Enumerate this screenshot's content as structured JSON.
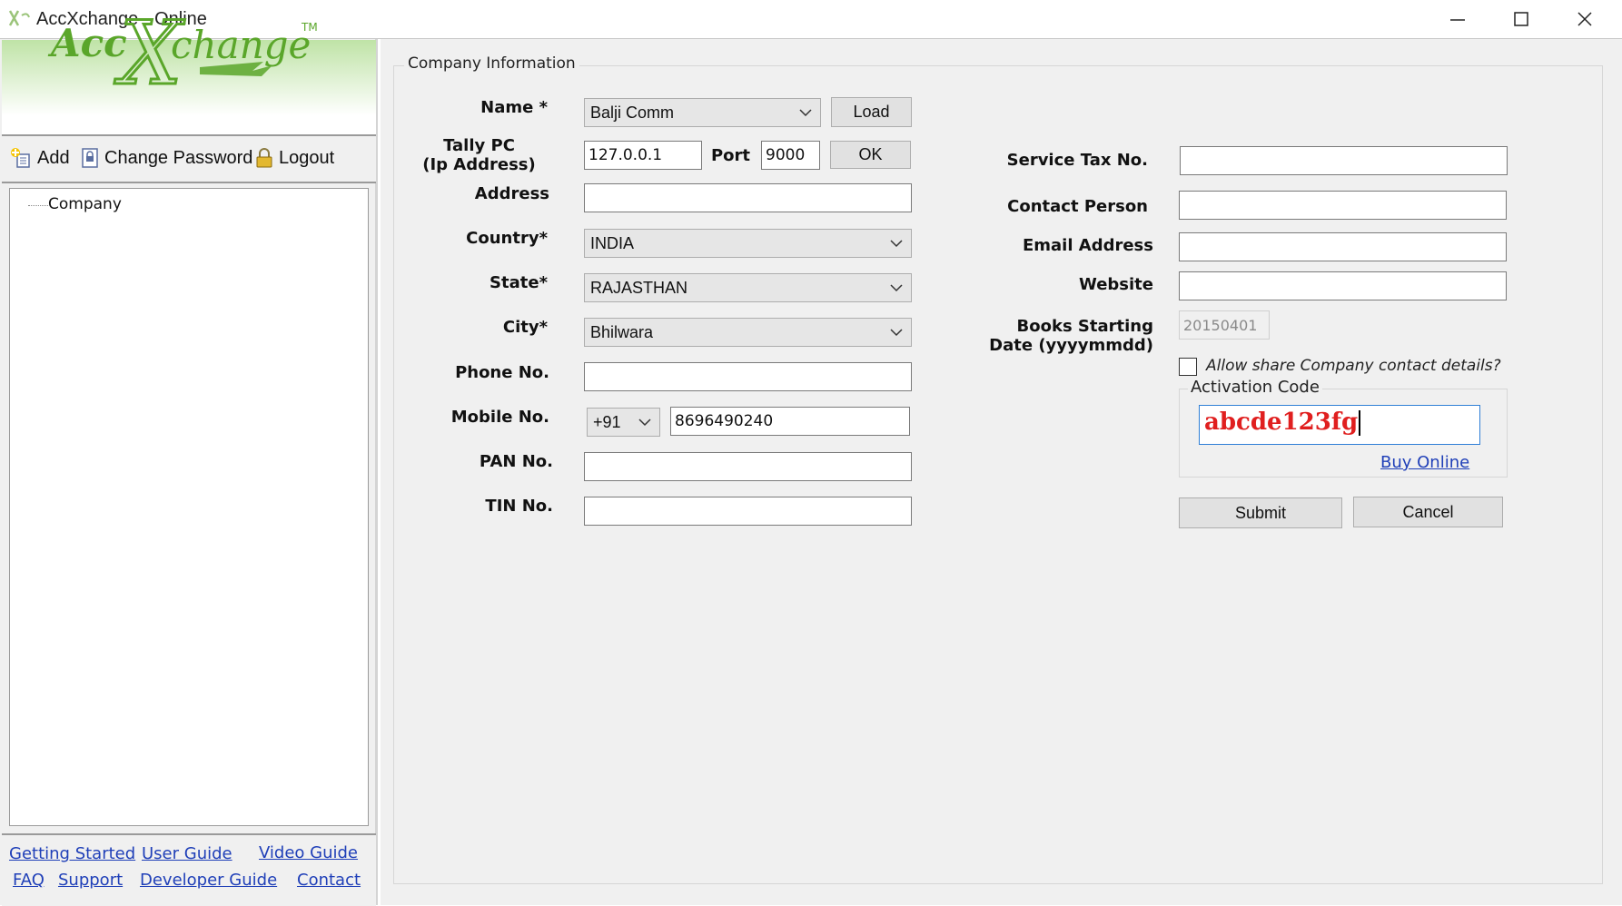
{
  "window": {
    "title": "AccXchange - Online"
  },
  "logo": {
    "text_acc": "Acc",
    "text_x": "X",
    "text_change": "change",
    "tm": "TM",
    "color": "#5aa62a"
  },
  "toolbar": {
    "add_label": "Add",
    "change_password_label": "Change Password",
    "logout_label": "Logout"
  },
  "tree": {
    "items": [
      "Company"
    ]
  },
  "links": {
    "getting_started": "Getting Started",
    "user_guide": "User Guide",
    "video_guide": "Video Guide",
    "faq": "FAQ",
    "support": "Support",
    "developer_guide": "Developer Guide",
    "contact": "Contact"
  },
  "form": {
    "group_title": "Company Information",
    "name": {
      "label": "Name *",
      "value": "Balji Comm"
    },
    "load_label": "Load",
    "tally_pc": {
      "label_line1": "Tally PC",
      "label_line2": "(Ip Address)",
      "value": "127.0.0.1"
    },
    "port": {
      "label": "Port",
      "value": "9000"
    },
    "ok_label": "OK",
    "address": {
      "label": "Address",
      "value": ""
    },
    "country": {
      "label": "Country*",
      "value": "INDIA"
    },
    "state": {
      "label": "State*",
      "value": "RAJASTHAN"
    },
    "city": {
      "label": "City*",
      "value": "Bhilwara"
    },
    "phone": {
      "label": "Phone No.",
      "value": ""
    },
    "mobile": {
      "label": "Mobile No.",
      "code": "+91",
      "value": "8696490240"
    },
    "pan": {
      "label": "PAN No.",
      "value": ""
    },
    "tin": {
      "label": "TIN No.",
      "value": ""
    },
    "service_tax": {
      "label": "Service Tax No.",
      "value": ""
    },
    "contact_person": {
      "label": "Contact Person",
      "value": ""
    },
    "email": {
      "label": "Email Address",
      "value": ""
    },
    "website": {
      "label": "Website",
      "value": ""
    },
    "books_start": {
      "label_line1": "Books Starting",
      "label_line2": "Date (yyyymmdd)",
      "value": "20150401"
    },
    "share_label": "Allow share Company contact details?",
    "activation": {
      "title": "Activation Code",
      "value": "abcde123fg",
      "buy_online": "Buy Online"
    },
    "submit_label": "Submit",
    "cancel_label": "Cancel"
  },
  "colors": {
    "accent_green": "#5aa62a",
    "activation_text": "#e01f1f",
    "link_blue": "#1f3fb8"
  }
}
